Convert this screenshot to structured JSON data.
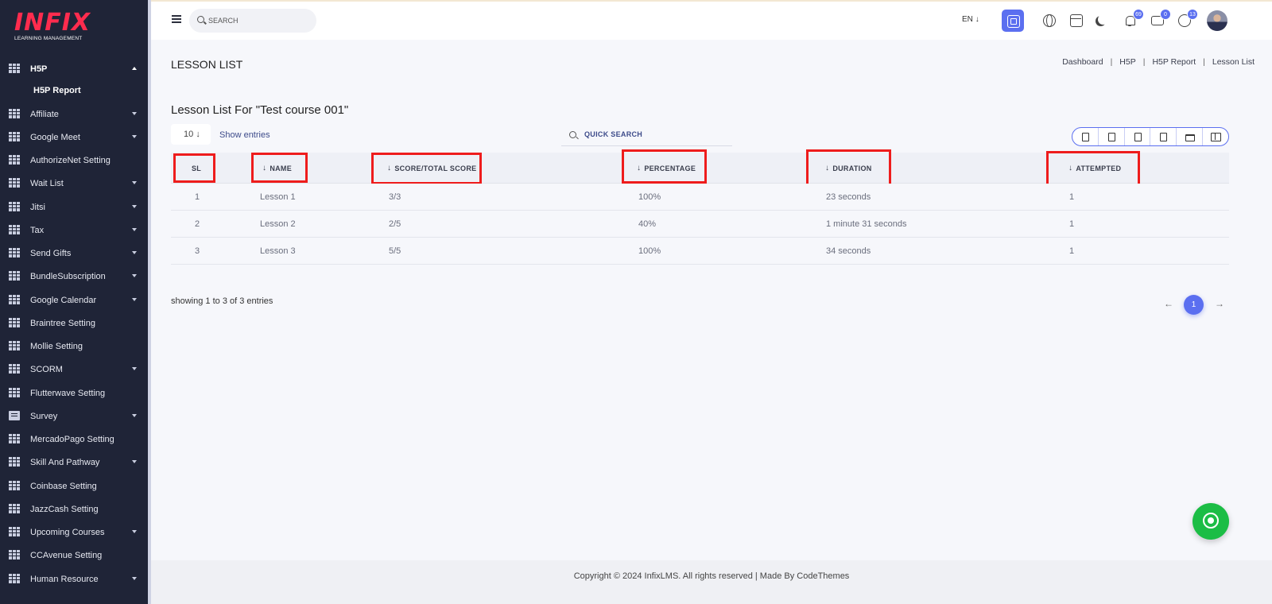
{
  "brand": {
    "logo_text": "INFIX",
    "logo_sub": "LEARNING MANAGEMENT"
  },
  "sidebar": {
    "items": [
      {
        "label": "H5P",
        "icon": "grid-icon",
        "expanded": true
      },
      {
        "label": "Affiliate",
        "icon": "grid-icon"
      },
      {
        "label": "Google Meet",
        "icon": "grid-icon"
      },
      {
        "label": "AuthorizeNet Setting",
        "icon": "grid-icon"
      },
      {
        "label": "Wait List",
        "icon": "grid-icon"
      },
      {
        "label": "Jitsi",
        "icon": "grid-icon"
      },
      {
        "label": "Tax",
        "icon": "grid-icon"
      },
      {
        "label": "Send Gifts",
        "icon": "grid-icon"
      },
      {
        "label": "BundleSubscription",
        "icon": "grid-icon"
      },
      {
        "label": "Google Calendar",
        "icon": "grid-icon"
      },
      {
        "label": "Braintree Setting",
        "icon": "grid-icon"
      },
      {
        "label": "Mollie Setting",
        "icon": "grid-icon"
      },
      {
        "label": "SCORM",
        "icon": "grid-icon"
      },
      {
        "label": "Flutterwave Setting",
        "icon": "grid-icon"
      },
      {
        "label": "Survey",
        "icon": "document-icon"
      },
      {
        "label": "MercadoPago Setting",
        "icon": "grid-icon"
      },
      {
        "label": "Skill And Pathway",
        "icon": "grid-icon"
      },
      {
        "label": "Coinbase Setting",
        "icon": "grid-icon"
      },
      {
        "label": "JazzCash Setting",
        "icon": "grid-icon"
      },
      {
        "label": "Upcoming Courses",
        "icon": "grid-icon"
      },
      {
        "label": "CCAvenue Setting",
        "icon": "grid-icon"
      },
      {
        "label": "Human Resource",
        "icon": "grid-icon"
      }
    ],
    "sub_item": "H5P Report"
  },
  "header": {
    "search_placeholder": "SEARCH",
    "language": "EN",
    "notifications_count": "69",
    "messages_count": "0",
    "whatsapp_count": "13",
    "accent_color": "#5b6ff0"
  },
  "page": {
    "title": "LESSON LIST",
    "breadcrumb": [
      "Dashboard",
      "H5P",
      "H5P Report",
      "Lesson List"
    ],
    "section_title": "Lesson List For \"Test course 001\"",
    "entries_value": "10",
    "show_entries_label": "Show entries",
    "quick_search_label": "QUICK SEARCH"
  },
  "table": {
    "columns": [
      "SL",
      "NAME",
      "SCORE/TOTAL SCORE",
      "PERCENTAGE",
      "DURATION",
      "ATTEMPTED"
    ],
    "rows": [
      [
        "1",
        "Lesson 1",
        "3/3",
        "100%",
        "23 seconds",
        "1"
      ],
      [
        "2",
        "Lesson 2",
        "2/5",
        "40%",
        "1 minute 31 seconds",
        "1"
      ],
      [
        "3",
        "Lesson 3",
        "5/5",
        "100%",
        "34 seconds",
        "1"
      ]
    ]
  },
  "pagination": {
    "summary": "showing 1 to 3 of 3 entries",
    "current_page": "1"
  },
  "footer": {
    "text": "Copyright © 2024 InfixLMS. All rights reserved | Made By CodeThemes"
  }
}
